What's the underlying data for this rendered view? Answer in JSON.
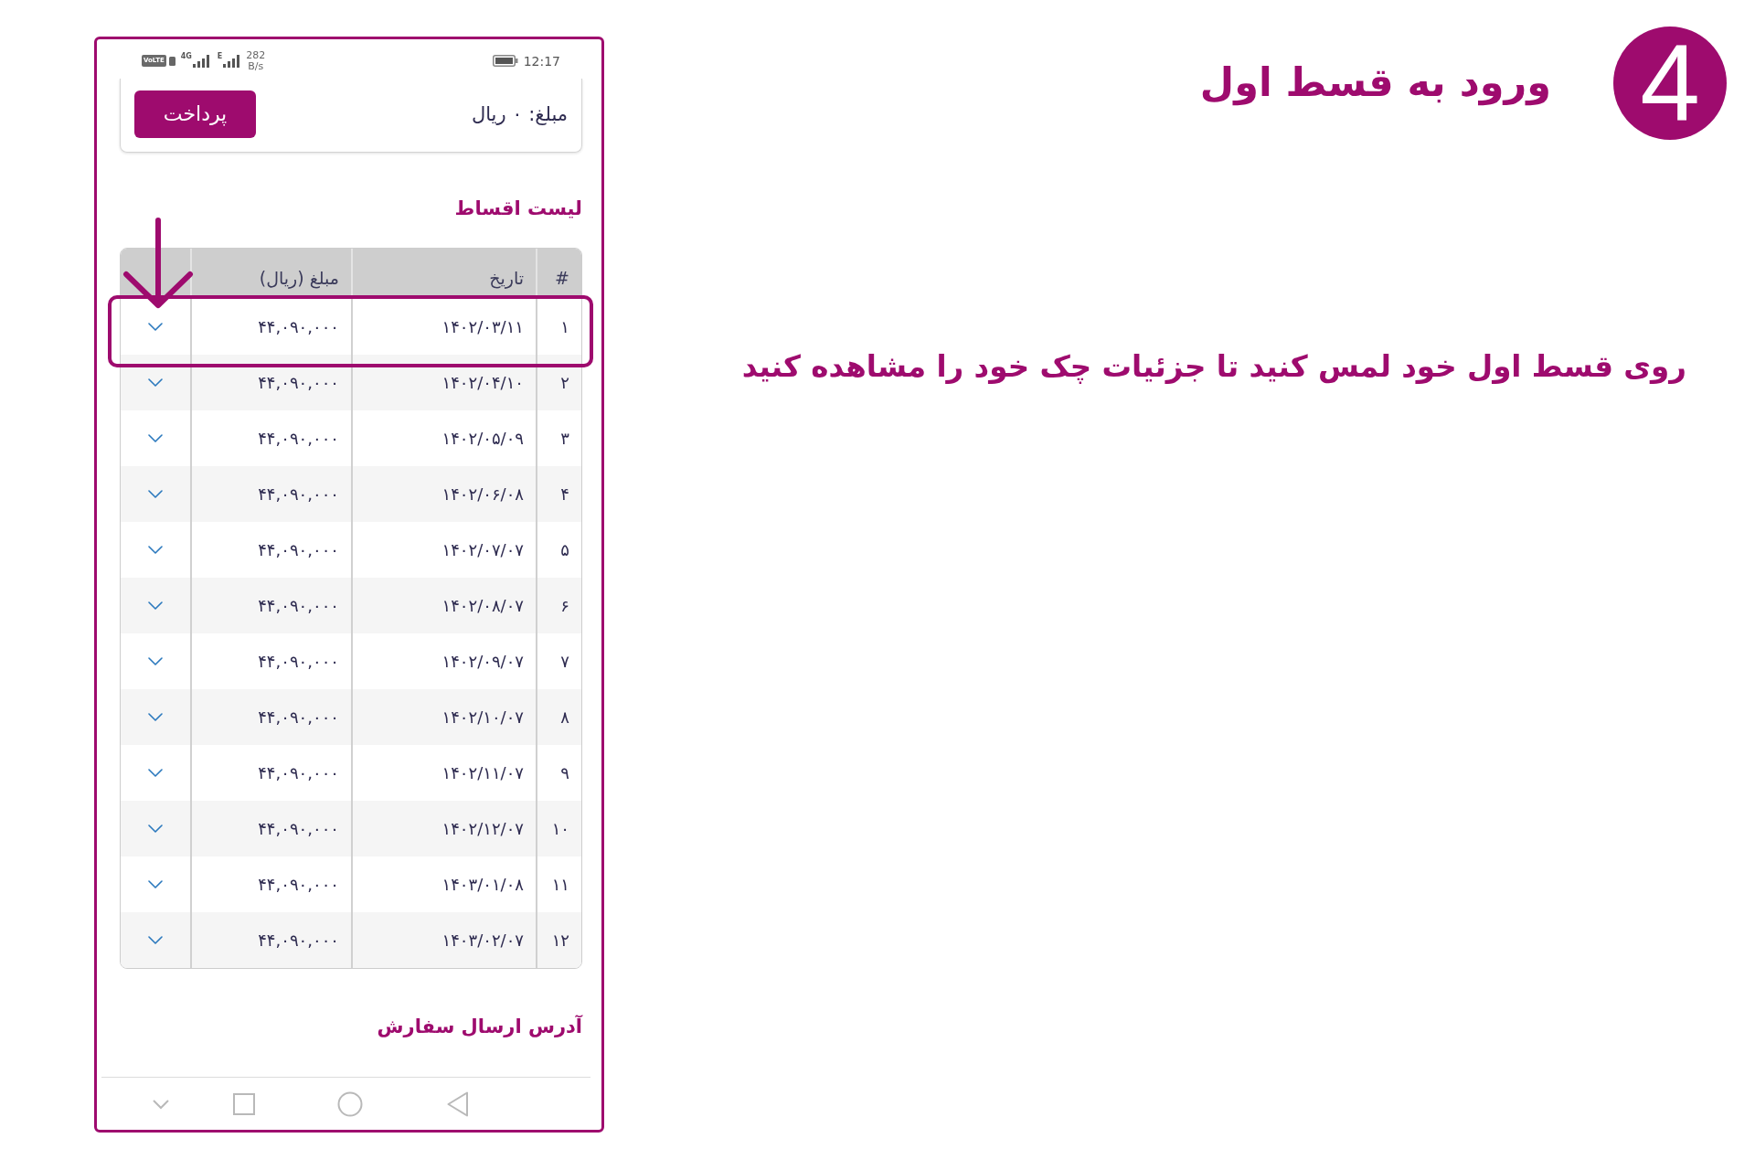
{
  "status_bar": {
    "volte": "VoLTE",
    "sim1_network": "4G",
    "sim2_network": "E",
    "speed_value": "282",
    "speed_unit": "B/s",
    "time": "12:17"
  },
  "payment_card": {
    "amount": "مبلغ: ۰ ریال",
    "pay_button": "پرداخت"
  },
  "installments": {
    "title": "لیست اقساط",
    "columns": [
      "#",
      "تاریخ",
      "مبلغ (ریال)"
    ],
    "rows": [
      {
        "index": "۱",
        "date": "۱۴۰۲/۰۳/۱۱",
        "amount": "۴۴,۰۹۰,۰۰۰",
        "expanded": false,
        "highlighted": true
      },
      {
        "index": "۲",
        "date": "۱۴۰۲/۰۴/۱۰",
        "amount": "۴۴,۰۹۰,۰۰۰",
        "expanded": false,
        "highlighted": false
      },
      {
        "index": "۳",
        "date": "۱۴۰۲/۰۵/۰۹",
        "amount": "۴۴,۰۹۰,۰۰۰",
        "expanded": false,
        "highlighted": false
      },
      {
        "index": "۴",
        "date": "۱۴۰۲/۰۶/۰۸",
        "amount": "۴۴,۰۹۰,۰۰۰",
        "expanded": false,
        "highlighted": false
      },
      {
        "index": "۵",
        "date": "۱۴۰۲/۰۷/۰۷",
        "amount": "۴۴,۰۹۰,۰۰۰",
        "expanded": false,
        "highlighted": false
      },
      {
        "index": "۶",
        "date": "۱۴۰۲/۰۸/۰۷",
        "amount": "۴۴,۰۹۰,۰۰۰",
        "expanded": false,
        "highlighted": false
      },
      {
        "index": "۷",
        "date": "۱۴۰۲/۰۹/۰۷",
        "amount": "۴۴,۰۹۰,۰۰۰",
        "expanded": false,
        "highlighted": false
      },
      {
        "index": "۸",
        "date": "۱۴۰۲/۱۰/۰۷",
        "amount": "۴۴,۰۹۰,۰۰۰",
        "expanded": false,
        "highlighted": false
      },
      {
        "index": "۹",
        "date": "۱۴۰۲/۱۱/۰۷",
        "amount": "۴۴,۰۹۰,۰۰۰",
        "expanded": false,
        "highlighted": false
      },
      {
        "index": "۱۰",
        "date": "۱۴۰۲/۱۲/۰۷",
        "amount": "۴۴,۰۹۰,۰۰۰",
        "expanded": false,
        "highlighted": false
      },
      {
        "index": "۱۱",
        "date": "۱۴۰۳/۰۱/۰۸",
        "amount": "۴۴,۰۹۰,۰۰۰",
        "expanded": false,
        "highlighted": false
      },
      {
        "index": "۱۲",
        "date": "۱۴۰۳/۰۲/۰۷",
        "amount": "۴۴,۰۹۰,۰۰۰",
        "expanded": false,
        "highlighted": false
      }
    ]
  },
  "address_section": {
    "title": "آدرس ارسال سفارش"
  },
  "step": {
    "number": "4",
    "title": "ورود به قسط اول",
    "instruction": "روی قسط اول خود لمس کنید تا جزئیات چک خود را مشاهده کنید"
  }
}
